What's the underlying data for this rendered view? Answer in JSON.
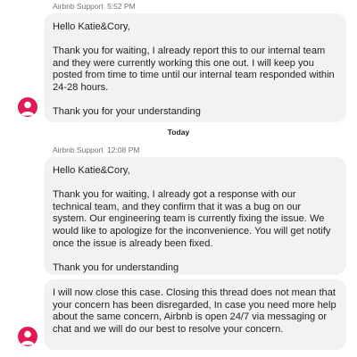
{
  "messages": [
    {
      "sender": "Airbnb Support",
      "time": "5:52 PM",
      "bubbles": [
        {
          "paragraphs": [
            "Hello Katie&Cory,",
            "Thank you for waiting, I already report this to our internal team and they were currently working this one out. I will keep you posted from time to time until our internal team responded within 24-28 hours.",
            "Thank you for your understanding"
          ]
        }
      ]
    },
    {
      "sender": "Airbnb Support",
      "time": "12:08 PM",
      "bubbles": [
        {
          "paragraphs": [
            "Hello Katie&Cory,",
            "Thank you for waiting, I already got a response with our technical team, and they confirm that it was a bug on our system. Our engineering team is currently fixing the issue. We would like to apologize for the inconvenience. You will get notify once the issue is already been fixed.",
            "Thank you for understanding"
          ]
        },
        {
          "paragraphs": [
            "I will now close this case. Closing this thread does not mean that your concern has been disregarded, In case you need more help about the same concern, Airbnb is open 24/7 via messaging or chat and we will do our best to resolve your concern."
          ]
        }
      ]
    }
  ],
  "day_divider": "Today",
  "colors": {
    "avatar": "#e11a55",
    "bubble": "#f2f2f2",
    "meta_text": "#717171"
  },
  "icons": {
    "avatar": "user-silhouette-icon"
  }
}
